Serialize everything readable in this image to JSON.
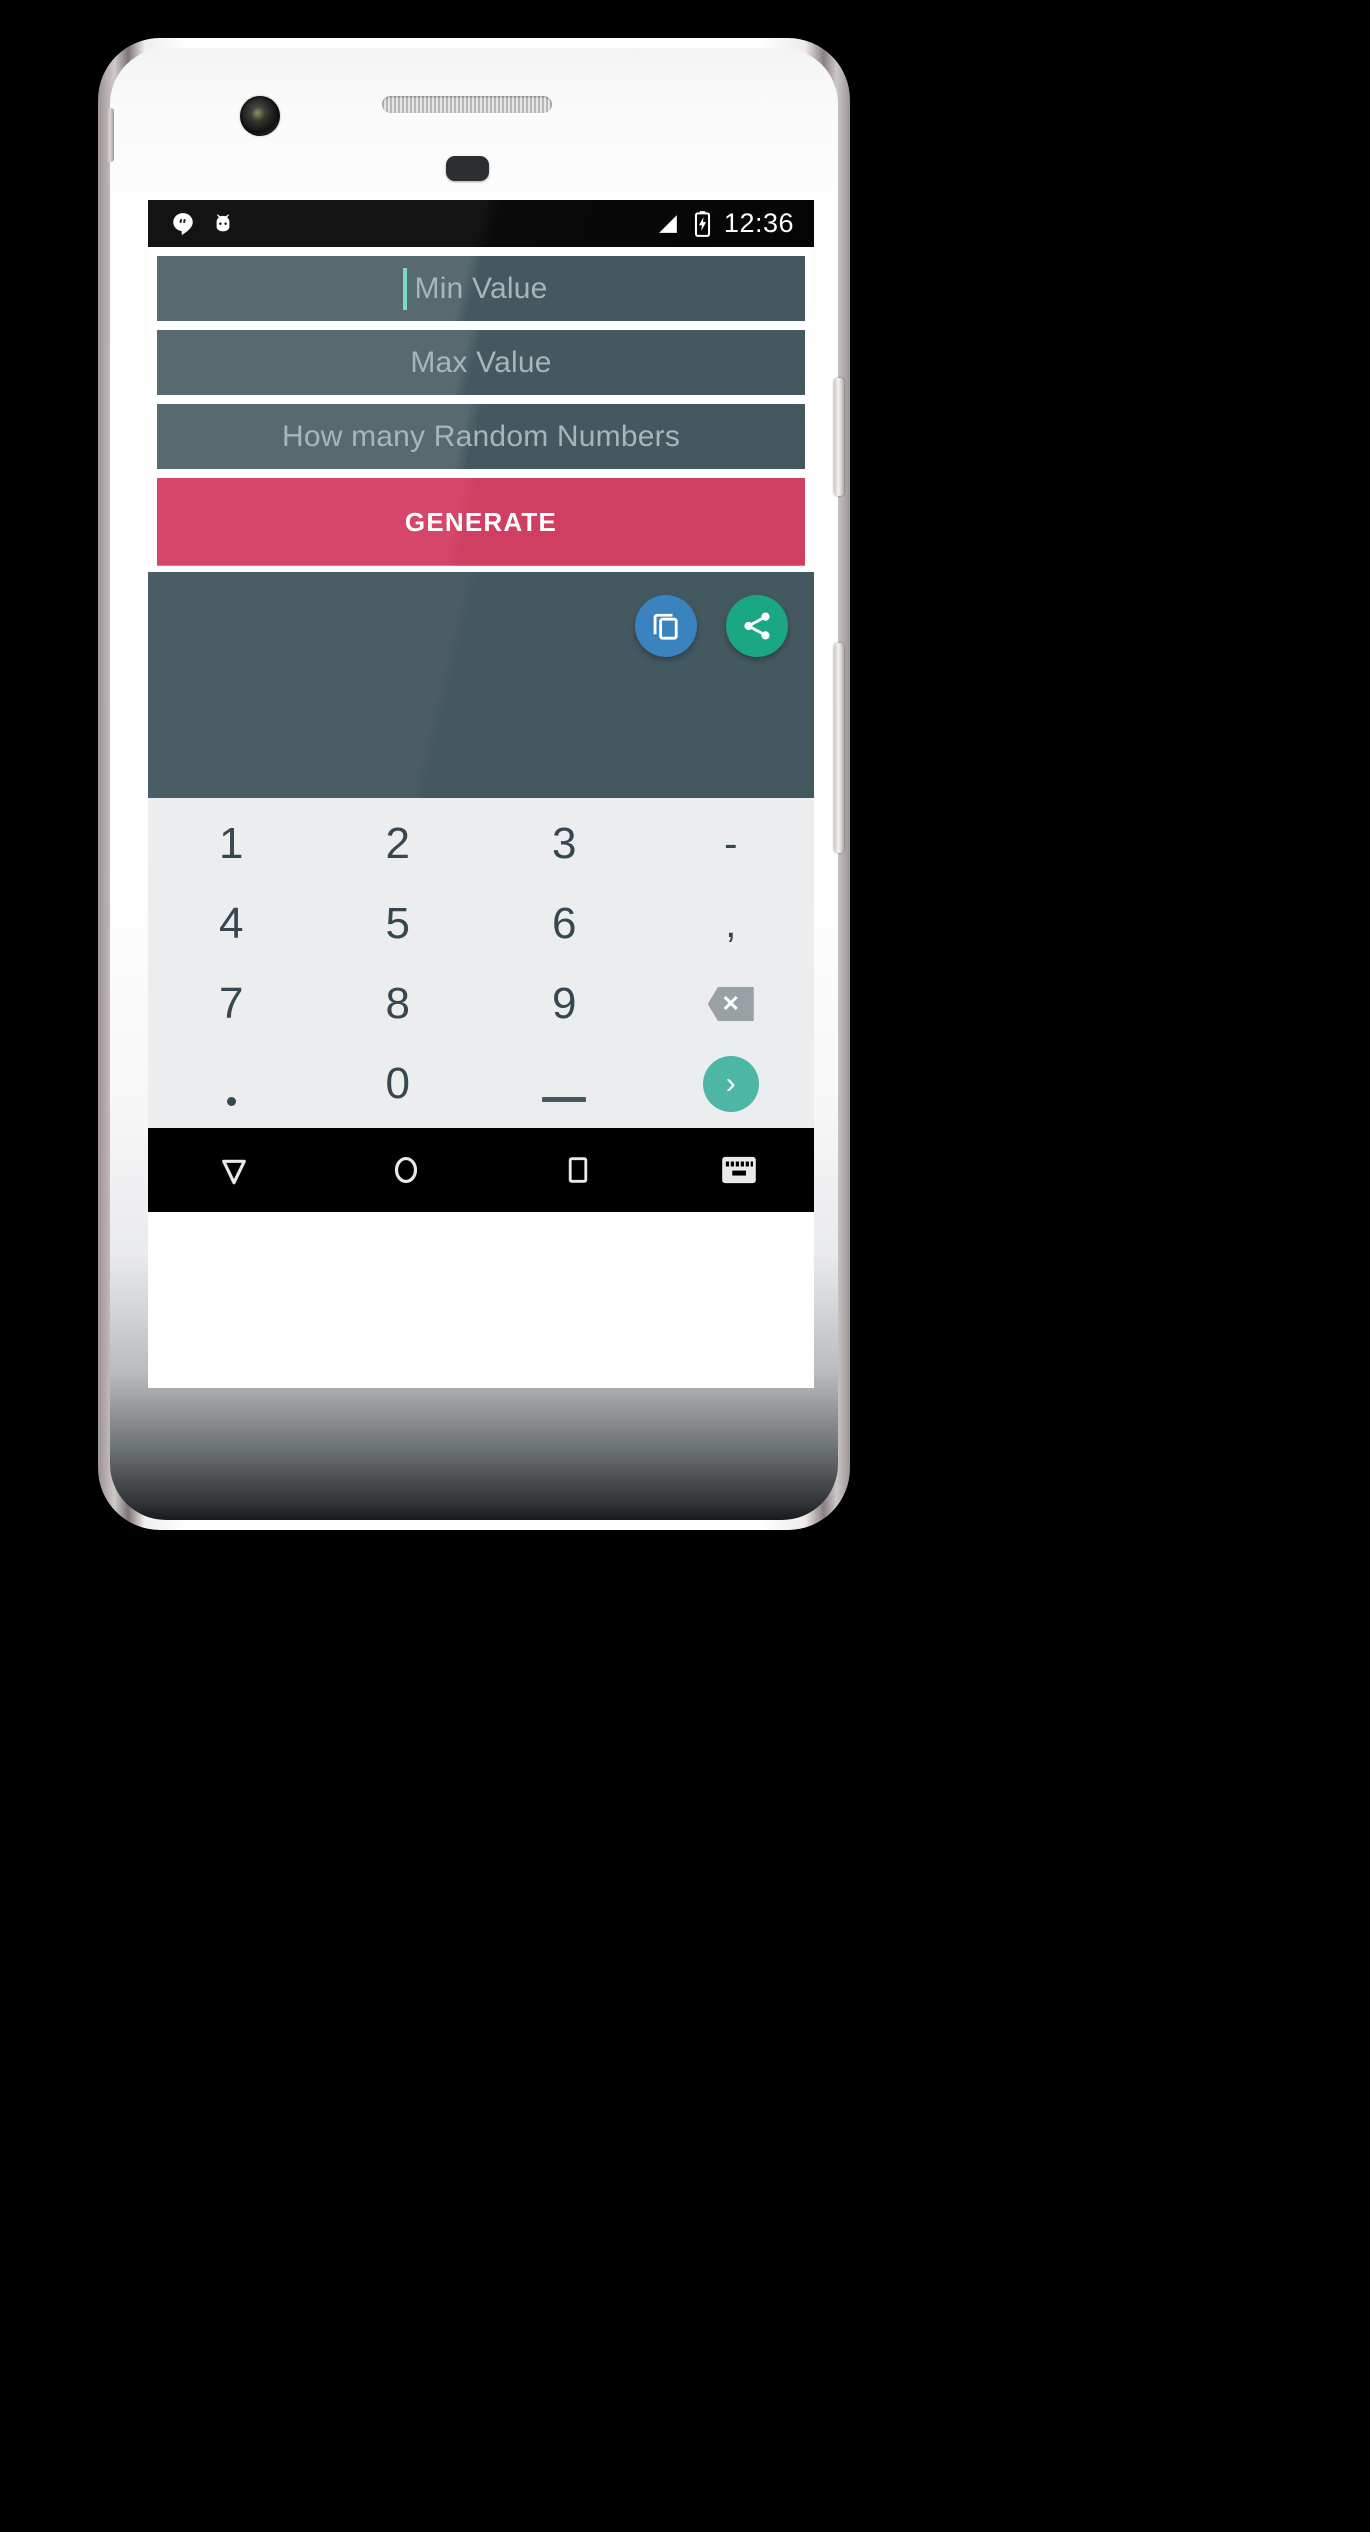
{
  "device": {
    "name": "android-phone-white",
    "hardware": {
      "front_camera": "front-camera",
      "earpiece": "earpiece-speaker",
      "proximity_sensor": "proximity-sensor",
      "power_button": "power-button",
      "volume_button": "volume-button"
    }
  },
  "status_bar": {
    "icons": [
      "hangouts-icon",
      "cyanogenmod-icon"
    ],
    "signal": "signal-icon",
    "battery": "battery-charging-icon",
    "clock": "12:36"
  },
  "app": {
    "fields": [
      {
        "name": "min-value-input",
        "placeholder": "Min Value",
        "value": "",
        "focused": true
      },
      {
        "name": "max-value-input",
        "placeholder": "Max Value",
        "value": "",
        "focused": false
      },
      {
        "name": "count-value-input",
        "placeholder": "How many Random Numbers",
        "value": "",
        "focused": false
      }
    ],
    "generate_button": {
      "label": "GENERATE"
    },
    "result_panel": {
      "value": "",
      "actions": [
        {
          "name": "copy-fab",
          "icon": "copy-icon",
          "color": "#3b83be"
        },
        {
          "name": "share-fab",
          "icon": "share-icon",
          "color": "#1aa883"
        }
      ]
    }
  },
  "keyboard": {
    "rows": [
      [
        {
          "label": "1",
          "type": "digit"
        },
        {
          "label": "2",
          "type": "digit"
        },
        {
          "label": "3",
          "type": "digit"
        },
        {
          "label": "-",
          "type": "symbol"
        }
      ],
      [
        {
          "label": "4",
          "type": "digit"
        },
        {
          "label": "5",
          "type": "digit"
        },
        {
          "label": "6",
          "type": "digit"
        },
        {
          "label": ",",
          "type": "symbol"
        }
      ],
      [
        {
          "label": "7",
          "type": "digit"
        },
        {
          "label": "8",
          "type": "digit"
        },
        {
          "label": "9",
          "type": "digit"
        },
        {
          "label": "",
          "type": "backspace"
        }
      ],
      [
        {
          "label": ".",
          "type": "dot"
        },
        {
          "label": "0",
          "type": "digit"
        },
        {
          "label": "",
          "type": "underscore"
        },
        {
          "label": "",
          "type": "enter"
        }
      ]
    ]
  },
  "nav_bar": {
    "buttons": [
      {
        "name": "back-button",
        "icon": "back-triangle-icon"
      },
      {
        "name": "home-button",
        "icon": "home-circle-icon"
      },
      {
        "name": "recents-button",
        "icon": "recents-square-icon"
      },
      {
        "name": "keyboard-toggle",
        "icon": "keyboard-icon"
      }
    ]
  },
  "colors": {
    "field_bg": "#44585f",
    "accent_pink": "#d03e62",
    "result_bg": "#44585f",
    "keyboard_bg": "#ebedef",
    "caret": "#7fd6c8",
    "copy_blue": "#3b83be",
    "share_green": "#1aa883",
    "enter_teal": "#4db6a4",
    "placeholder": "#a6b6ba"
  }
}
